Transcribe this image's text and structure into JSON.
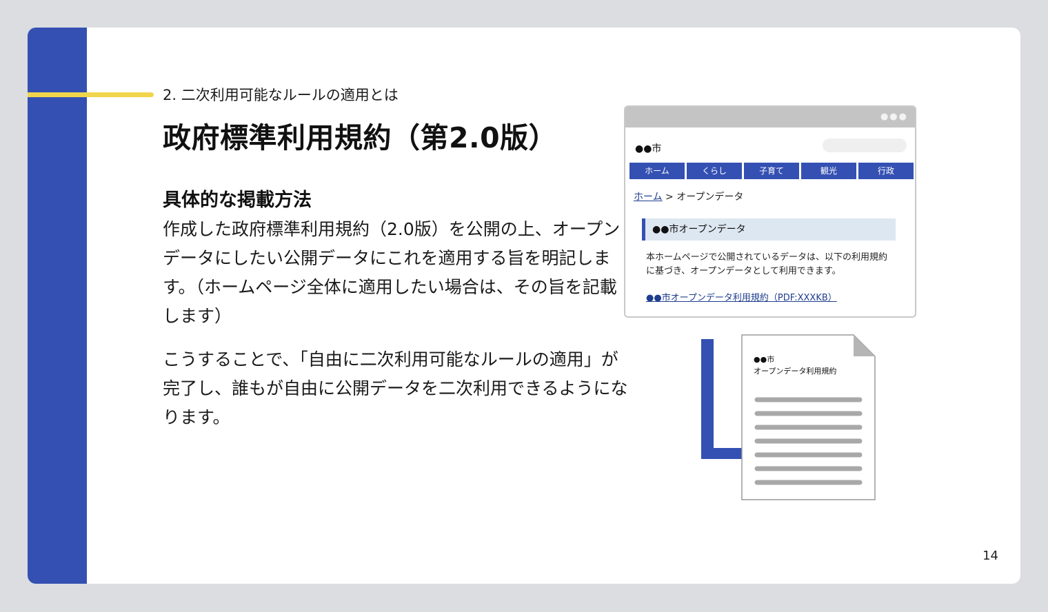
{
  "slide": {
    "section_label": "2. 二次利用可能なルールの適用とは",
    "title": "政府標準利用規約（第2.0版）",
    "subtitle": "具体的な掲載方法",
    "paragraph1": "作成した政府標準利用規約（2.0版）を公開の上、オープンデータにしたい公開データにこれを適用する旨を明記します。（ホームページ全体に適用したい場合は、その旨を記載します）",
    "paragraph2": "こうすることで、「自由に二次利用可能なルールの適用」が完了し、誰もが自由に公開データを二次利用できるようになります。",
    "page_number": "14"
  },
  "browser_mock": {
    "dots": "●●●",
    "site_name": "●●市",
    "nav": [
      "ホーム",
      "くらし",
      "子育て",
      "観光",
      "行政"
    ],
    "breadcrumb_home": "ホーム",
    "breadcrumb_rest": " > オープンデータ",
    "section_heading": "●●市オープンデータ",
    "body_text": "本ホームページで公開されているデータは、以下の利用規約に基づき、オープンデータとして利用できます。",
    "link_text": "●●市オープンデータ利用規約（PDF:XXXKB）"
  },
  "document_mock": {
    "line1": "●●市",
    "line2": "オープンデータ利用規約"
  },
  "colors": {
    "brand_blue": "#3450b3",
    "accent_yellow": "#f0d54c",
    "link_blue": "#1e3d8f"
  }
}
